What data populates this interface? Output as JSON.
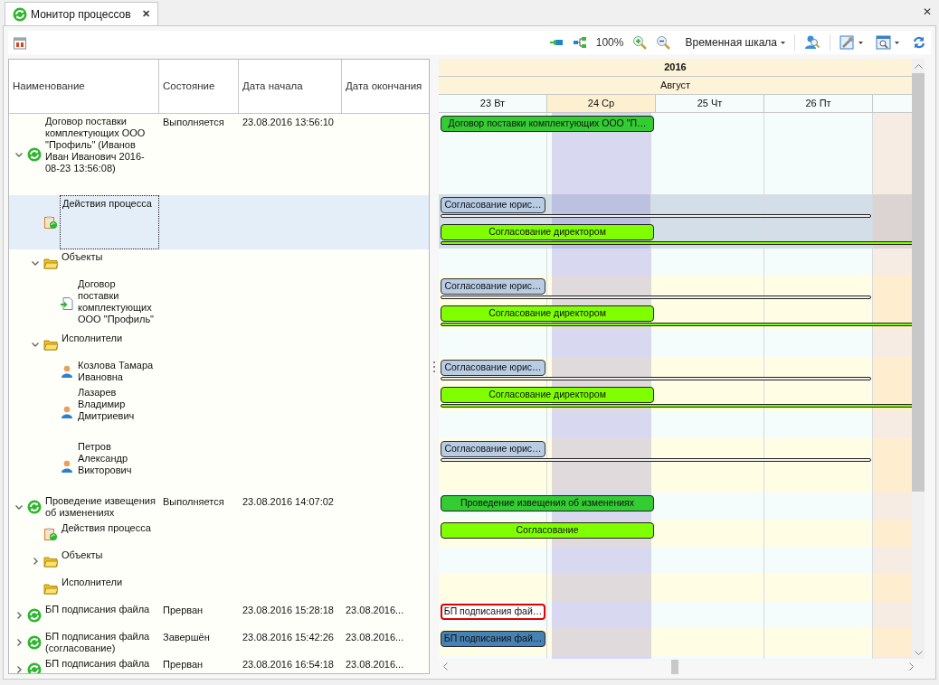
{
  "tab": {
    "title": "Монитор процессов",
    "close": "✕"
  },
  "window_close": "✕",
  "toolbar": {
    "zoom": "100%",
    "timescale": "Временная шкала"
  },
  "tree": {
    "columns": [
      "Наименование",
      "Состояние",
      "Дата начала",
      "Дата окончания"
    ],
    "items": [
      {
        "kind": "process",
        "name": "Договор поставки комплектующих ООО \"Профиль\" (Иванов Иван Иванович 2016-08-23 13:56:08)",
        "status": "Выполняется",
        "start": "23.08.2016 13:56:10",
        "expanded": true,
        "selected": false,
        "lanes": [
          {
            "highlighted": false,
            "bar": {
              "kind": "process",
              "label": "Договор поставки комплектующих ООО \"П…"
            }
          },
          {
            "highlighted": false
          },
          {
            "highlighted": false
          }
        ],
        "children": [
          {
            "kind": "actions",
            "name": "Действия процесса",
            "selected": true,
            "lanes": [
              {
                "bar": {
                  "kind": "pending",
                  "label": "Согласование юрис…"
                },
                "line": {
                  "kind": "pending"
                }
              },
              {
                "bar": {
                  "kind": "task",
                  "label": "Согласование директором"
                },
                "line": {
                  "kind": "task"
                }
              }
            ]
          },
          {
            "kind": "folder",
            "name": "Объекты",
            "expanded": true,
            "selected": false,
            "lanes": [
              {
                "highlighted": false
              }
            ],
            "children": [
              {
                "kind": "document",
                "name": "Договор поставки комплектующих ООО \"Профиль\"",
                "selected": false,
                "lanes": [
                  {
                    "highlighted": true,
                    "bar": {
                      "kind": "pending",
                      "label": "Согласование юрис…"
                    },
                    "line": {
                      "kind": "pending"
                    }
                  },
                  {
                    "highlighted": true,
                    "bar": {
                      "kind": "task",
                      "label": "Согласование директором"
                    },
                    "line": {
                      "kind": "task"
                    }
                  }
                ]
              }
            ]
          },
          {
            "kind": "folder",
            "name": "Исполнители",
            "expanded": true,
            "selected": false,
            "lanes": [
              {
                "highlighted": false
              }
            ],
            "children": [
              {
                "kind": "person",
                "name": "Козлова Тамара Ивановна",
                "selected": false,
                "lanes": [
                  {
                    "highlighted": true,
                    "bar": {
                      "kind": "pending",
                      "label": "Согласование юрис…"
                    },
                    "line": {
                      "kind": "pending"
                    }
                  }
                ]
              },
              {
                "kind": "person",
                "name": "Лазарев Владимир Дмитриевич",
                "selected": false,
                "lanes": [
                  {
                    "highlighted": true,
                    "bar": {
                      "kind": "task",
                      "label": "Согласование директором"
                    },
                    "line": {
                      "kind": "task"
                    }
                  },
                  {
                    "highlighted": false
                  }
                ]
              },
              {
                "kind": "person",
                "name": "Петров Александр Викторович",
                "selected": false,
                "lanes": [
                  {
                    "highlighted": true,
                    "bar": {
                      "kind": "pending",
                      "label": "Согласование юрис…"
                    },
                    "line": {
                      "kind": "pending"
                    }
                  },
                  {
                    "highlighted": true
                  }
                ]
              }
            ]
          }
        ]
      },
      {
        "kind": "process",
        "name": "Проведение извещения об изменениях",
        "status": "Выполняется",
        "start": "23.08.2016 14:07:02",
        "expanded": true,
        "selected": false,
        "lanes": [
          {
            "highlighted": false,
            "bar": {
              "kind": "process",
              "label": "Проведение извещения об изменениях"
            }
          }
        ],
        "children": [
          {
            "kind": "actions",
            "name": "Действия процесса",
            "selected": false,
            "lanes": [
              {
                "highlighted": true,
                "bar": {
                  "kind": "task",
                  "label": "Согласование"
                }
              }
            ]
          },
          {
            "kind": "folder",
            "name": "Объекты",
            "expanded": false,
            "selected": false,
            "lanes": [
              {
                "highlighted": false
              }
            ]
          },
          {
            "kind": "folder",
            "name": "Исполнители",
            "selected": false,
            "lanes": [
              {
                "highlighted": true
              }
            ]
          }
        ]
      },
      {
        "kind": "process",
        "name": "БП подписания файла",
        "status": "Прерван",
        "start": "23.08.2016 15:28:18",
        "end": "23.08.2016...",
        "expanded": false,
        "selected": false,
        "lanes": [
          {
            "highlighted": false,
            "bar": {
              "kind": "interrupted",
              "label": "БП подписания фай…"
            }
          }
        ]
      },
      {
        "kind": "process",
        "name": "БП подписания файла (согласование)",
        "status": "Завершён",
        "start": "23.08.2016 15:42:26",
        "end": "23.08.2016...",
        "expanded": false,
        "selected": false,
        "lanes": [
          {
            "highlighted": true,
            "bar": {
              "kind": "completed",
              "label": "БП подписания фай…"
            }
          }
        ]
      },
      {
        "kind": "process",
        "name": "БП подписания файла",
        "status": "Прерван",
        "start": "23.08.2016 16:54:18",
        "end": "23.08.2016...",
        "expanded": false,
        "selected": false,
        "lanes": [
          {
            "highlighted": false
          }
        ]
      }
    ]
  },
  "gantt": {
    "year": "2016",
    "month": "Август",
    "days": [
      {
        "label": "23 Вт",
        "current": false
      },
      {
        "label": "24 Ср",
        "current": true
      },
      {
        "label": "25 Чт",
        "current": false
      },
      {
        "label": "26 Пт",
        "current": false
      }
    ]
  }
}
